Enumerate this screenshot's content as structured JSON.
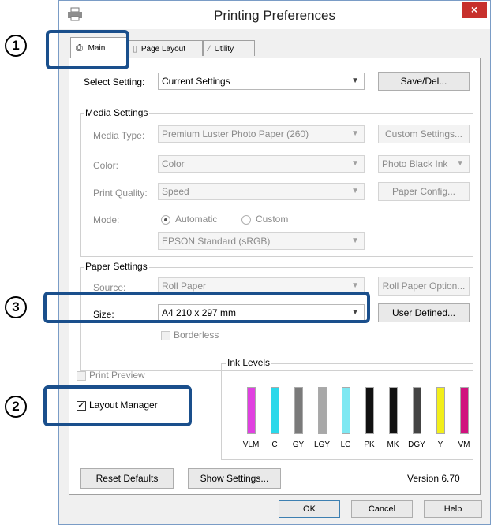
{
  "window": {
    "title": "Printing Preferences",
    "close": "×"
  },
  "tabs": [
    {
      "label": "Main",
      "icon": "printer-icon"
    },
    {
      "label": "Page Layout",
      "icon": "page-icon"
    },
    {
      "label": "Utility",
      "icon": "wrench-icon"
    }
  ],
  "select_setting": {
    "label": "Select Setting:",
    "value": "Current Settings",
    "button": "Save/Del..."
  },
  "media": {
    "title": "Media Settings",
    "media_type_label": "Media Type:",
    "media_type_value": "Premium Luster Photo Paper (260)",
    "custom_settings": "Custom Settings...",
    "color_label": "Color:",
    "color_value": "Color",
    "ink_value": "Photo Black Ink",
    "quality_label": "Print Quality:",
    "quality_value": "Speed",
    "paper_config": "Paper Config...",
    "mode_label": "Mode:",
    "mode_auto": "Automatic",
    "mode_custom": "Custom",
    "mode_profile": "EPSON Standard (sRGB)"
  },
  "paper": {
    "title": "Paper Settings",
    "source_label": "Source:",
    "source_value": "Roll Paper",
    "roll_option": "Roll Paper Option...",
    "size_label": "Size:",
    "size_value": "A4 210 x 297 mm",
    "user_defined": "User Defined...",
    "borderless": "Borderless"
  },
  "print_preview": "Print Preview",
  "layout_manager": "Layout Manager",
  "ink_levels": {
    "title": "Ink Levels",
    "inks": [
      {
        "name": "VLM",
        "color": "#e040e0",
        "level": 0.85
      },
      {
        "name": "C",
        "color": "#2ad8ea",
        "level": 0.85
      },
      {
        "name": "GY",
        "color": "#7a7a7a",
        "level": 0.85
      },
      {
        "name": "LGY",
        "color": "#a8a8a8",
        "level": 0.85
      },
      {
        "name": "LC",
        "color": "#7ee8f2",
        "level": 0.85
      },
      {
        "name": "PK",
        "color": "#111111",
        "level": 0.85
      },
      {
        "name": "MK",
        "color": "#111111",
        "level": 0.85
      },
      {
        "name": "DGY",
        "color": "#444444",
        "level": 0.85
      },
      {
        "name": "Y",
        "color": "#f2ee1a",
        "level": 0.85
      },
      {
        "name": "VM",
        "color": "#d0127e",
        "level": 0.85
      }
    ]
  },
  "reset_defaults": "Reset Defaults",
  "show_settings": "Show Settings...",
  "version": "Version 6.70",
  "footer": {
    "ok": "OK",
    "cancel": "Cancel",
    "help": "Help"
  },
  "callouts": {
    "one": "1",
    "two": "2",
    "three": "3"
  }
}
